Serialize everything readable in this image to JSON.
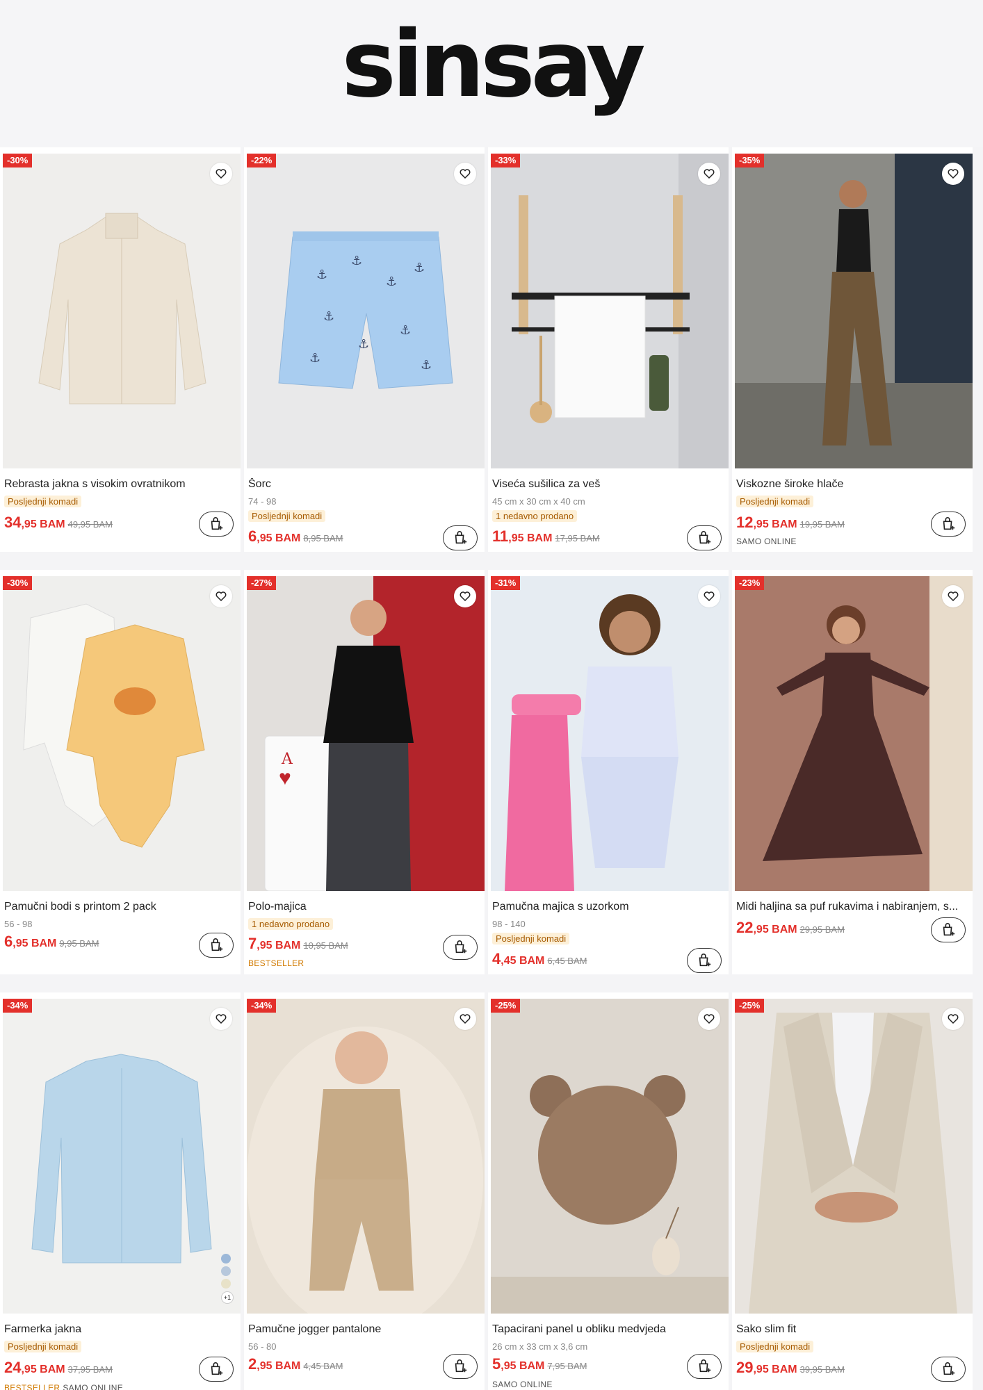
{
  "brand": {
    "logo": "sinsay"
  },
  "colors": {
    "discount": "#e3302b",
    "tag_bg": "#fdf0d8",
    "tag_text": "#a65a00"
  },
  "products": [
    {
      "badge": "-30%",
      "name": "Rebrasta jakna s visokim ovratnikom",
      "sizes": "",
      "tag": "Posljednji komadi",
      "price_int": "34",
      "price_dec": ",95 BAM",
      "old_price": "49,95 BAM",
      "note_best": "",
      "note": ""
    },
    {
      "badge": "-22%",
      "name": "Šorc",
      "sizes": "74 - 98",
      "tag": "Posljednji komadi",
      "price_int": "6",
      "price_dec": ",95 BAM",
      "old_price": "8,95 BAM",
      "note_best": "",
      "note": ""
    },
    {
      "badge": "-33%",
      "name": "Viseća sušilica za veš",
      "sizes": "45 cm x 30 cm x 40 cm",
      "tag": "1 nedavno prodano",
      "price_int": "11",
      "price_dec": ",95 BAM",
      "old_price": "17,95 BAM",
      "note_best": "",
      "note": ""
    },
    {
      "badge": "-35%",
      "name": "Viskozne široke hlače",
      "sizes": "",
      "tag": "Posljednji komadi",
      "price_int": "12",
      "price_dec": ",95 BAM",
      "old_price": "19,95 BAM",
      "note_best": "",
      "note": "SAMO ONLINE"
    },
    {
      "badge": "-30%",
      "name": "Pamučni bodi s printom 2 pack",
      "sizes": "56 - 98",
      "tag": "",
      "price_int": "6",
      "price_dec": ",95 BAM",
      "old_price": "9,95 BAM",
      "note_best": "",
      "note": ""
    },
    {
      "badge": "-27%",
      "name": "Polo-majica",
      "sizes": "",
      "tag": "1 nedavno prodano",
      "price_int": "7",
      "price_dec": ",95 BAM",
      "old_price": "10,95 BAM",
      "note_best": "BESTSELLER",
      "note": ""
    },
    {
      "badge": "-31%",
      "name": "Pamučna majica s uzorkom",
      "sizes": "98 - 140",
      "tag": "Posljednji komadi",
      "price_int": "4",
      "price_dec": ",45 BAM",
      "old_price": "6,45 BAM",
      "note_best": "",
      "note": ""
    },
    {
      "badge": "-23%",
      "name": "Midi haljina sa puf rukavima i nabiranjem, s...",
      "sizes": "",
      "tag": "",
      "price_int": "22",
      "price_dec": ",95 BAM",
      "old_price": "29,95 BAM",
      "note_best": "",
      "note": ""
    },
    {
      "badge": "-34%",
      "name": "Farmerka jakna",
      "sizes": "",
      "tag": "Posljednji komadi",
      "price_int": "24",
      "price_dec": ",95 BAM",
      "old_price": "37,95 BAM",
      "note_best": "BESTSELLER",
      "note": "SAMO ONLINE"
    },
    {
      "badge": "-34%",
      "name": "Pamučne jogger pantalone",
      "sizes": "56 - 80",
      "tag": "",
      "price_int": "2",
      "price_dec": ",95 BAM",
      "old_price": "4,45 BAM",
      "note_best": "",
      "note": ""
    },
    {
      "badge": "-25%",
      "name": "Tapacirani panel u obliku medvjeda",
      "sizes": "26 cm x 33 cm x 3,6 cm",
      "tag": "",
      "price_int": "5",
      "price_dec": ",95 BAM",
      "old_price": "7,95 BAM",
      "note_best": "",
      "note": "SAMO ONLINE"
    },
    {
      "badge": "-25%",
      "name": "Sako slim fit",
      "sizes": "",
      "tag": "Posljednji komadi",
      "price_int": "29",
      "price_dec": ",95 BAM",
      "old_price": "39,95 BAM",
      "note_best": "",
      "note": ""
    }
  ],
  "extra_colors_label": "+1"
}
